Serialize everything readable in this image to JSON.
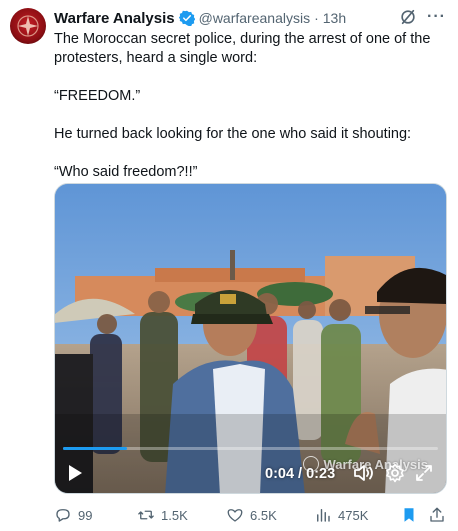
{
  "author": {
    "name": "Warfare Analysis",
    "handle": "@warfareanalysis",
    "time": "13h"
  },
  "tweet": {
    "paragraphs": [
      "The Moroccan secret police, during the arrest of one of the protesters, heard a single word:",
      "“FREEDOM.”",
      "He turned back looking for the one who said it shouting:",
      "“Who said freedom?!!”"
    ]
  },
  "video": {
    "watermark": "Warfare Analysis",
    "timecode": "0:04 / 0:23",
    "progress": 0.17
  },
  "actions": {
    "replies": "99",
    "reposts": "1.5K",
    "likes": "6.5K",
    "views": "475K"
  },
  "colors": {
    "accent": "#1d9bf0",
    "muted": "#536471",
    "text": "#0f1419"
  },
  "icons": [
    "verified-badge-icon",
    "grok-icon",
    "more-icon",
    "play-icon",
    "volume-icon",
    "gear-icon",
    "fullscreen-icon",
    "reply-icon",
    "repost-icon",
    "like-icon",
    "views-icon",
    "bookmark-icon",
    "share-icon"
  ]
}
